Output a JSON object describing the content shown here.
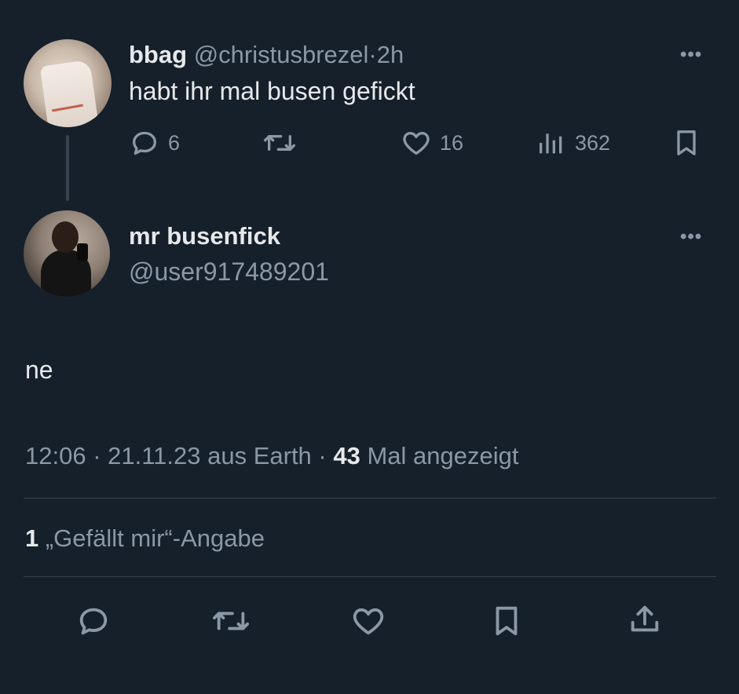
{
  "tweet1": {
    "display_name": "bbag",
    "handle": "@christusbrezel",
    "separator": "·",
    "time": "2h",
    "text": "habt ihr mal busen gefickt",
    "more": "•••",
    "stats": {
      "replies": "6",
      "likes": "16",
      "views": "362"
    }
  },
  "tweet2": {
    "display_name": "mr busenfick",
    "handle": "@user917489201",
    "more": "•••",
    "text": "ne",
    "timestamp": "12:06 · 21.11.23 aus Earth · ",
    "views_count": "43",
    "views_label": " Mal angezeigt",
    "likes_count": "1",
    "likes_label": " „Gefällt mir“-Angabe"
  },
  "icons": {
    "reply": "reply-icon",
    "retweet": "retweet-icon",
    "like": "heart-icon",
    "views": "views-icon",
    "bookmark": "bookmark-icon",
    "share": "share-icon"
  },
  "colors": {
    "background": "#15202b",
    "text": "#e7e9ea",
    "muted": "#8b98a5",
    "divider": "#38444d"
  }
}
